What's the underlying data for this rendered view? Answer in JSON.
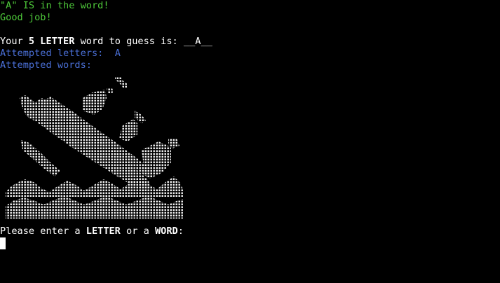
{
  "terminal": {
    "feedback_line": "\"A\" IS in the word!",
    "praise_line": "Good job!",
    "word_prompt": {
      "prefix": "Your ",
      "length": "5",
      "letter_word": "LETTER",
      "mid": " word to guess is: ",
      "masked_word": "__A__"
    },
    "attempted_letters": {
      "label": "Attempted letters:",
      "value": "A"
    },
    "attempted_words": {
      "label": "Attempted words:",
      "value": ""
    },
    "input_prompt": {
      "prefix": "Please enter a ",
      "letter": "LETTER",
      "mid": " or a ",
      "word": "WORD",
      "suffix": ":"
    }
  },
  "colors": {
    "background": "#000000",
    "success_text": "#4ec93a",
    "info_text": "#4a6fd6",
    "default_text": "#ffffff"
  },
  "art": {
    "icon": "sinking-ship-ascii-art"
  }
}
